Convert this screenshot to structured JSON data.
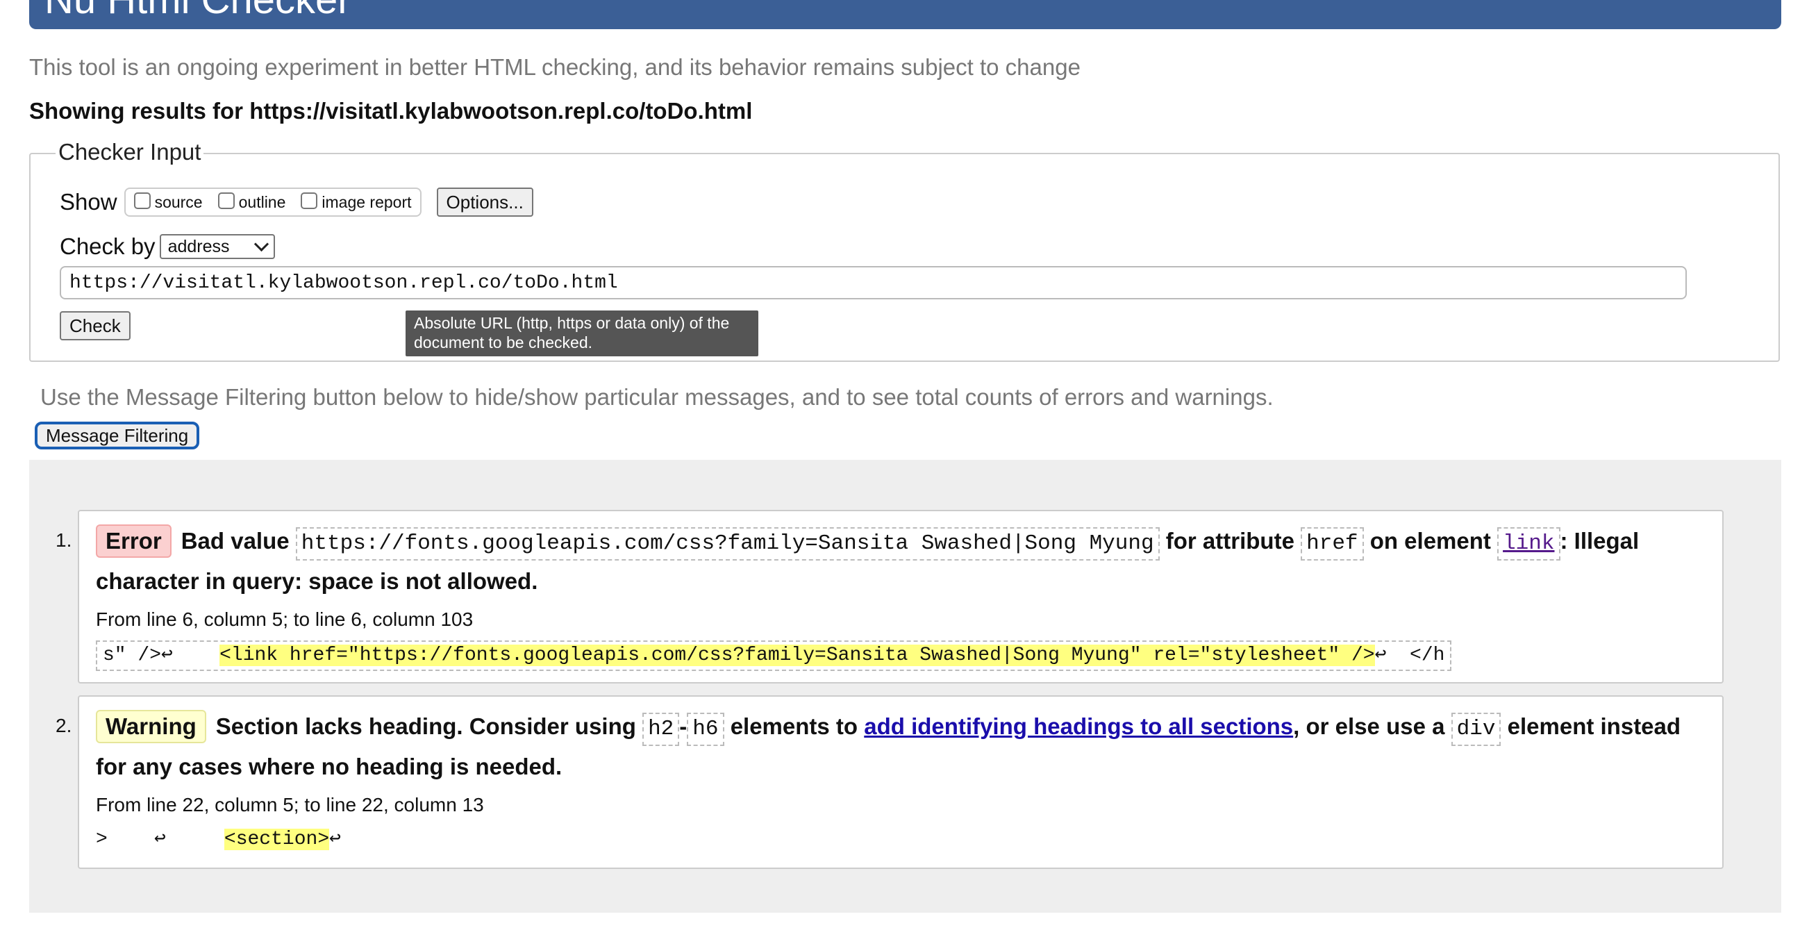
{
  "header": {
    "title": "Nu Html Checker"
  },
  "intro": "This tool is an ongoing experiment in better HTML checking, and its behavior remains subject to change",
  "showing": "Showing results for https://visitatl.kylabwootson.repl.co/toDo.html",
  "checker_input": {
    "legend": "Checker Input",
    "show_label": "Show",
    "show_options": [
      "source",
      "outline",
      "image report"
    ],
    "options_button": "Options...",
    "check_by_label": "Check by",
    "check_by_value": "address",
    "url_value": "https://visitatl.kylabwootson.repl.co/toDo.html",
    "check_button": "Check",
    "tooltip": "Absolute URL (http, https or data only) of the document to be checked."
  },
  "filter_hint": "Use the Message Filtering button below to hide/show particular messages, and to see total counts of errors and warnings.",
  "filter_button": "Message Filtering",
  "messages": [
    {
      "number": "1.",
      "type": "Error",
      "text_1": "Bad value",
      "code_1": "https://fonts.googleapis.com/css?family=Sansita Swashed|Song Myung",
      "text_2": "for attribute",
      "code_2": "href",
      "text_3": "on element",
      "code_3": "link",
      "text_4": ": Illegal character in query: space is not allowed.",
      "location": "From line 6, column 5; to line 6, column 103",
      "extract_before": "s\" />↩    ",
      "extract_mark": "<link href=\"https://fonts.googleapis.com/css?family=Sansita Swashed|Song Myung\" rel=\"stylesheet\" />",
      "extract_after": "↩  </h"
    },
    {
      "number": "2.",
      "type": "Warning",
      "text_1": "Section lacks heading. Consider using",
      "code_1": "h2",
      "dash": "-",
      "code_2": "h6",
      "text_2": "elements to",
      "link": "add identifying headings to all sections",
      "text_3": ", or else use a",
      "code_3": "div",
      "text_4": "element instead for any cases where no heading is needed.",
      "location": "From line 22, column 5; to line 22, column 13",
      "extract_before": ">    ↩     ",
      "extract_mark": "<section>",
      "extract_after": "↩"
    }
  ]
}
